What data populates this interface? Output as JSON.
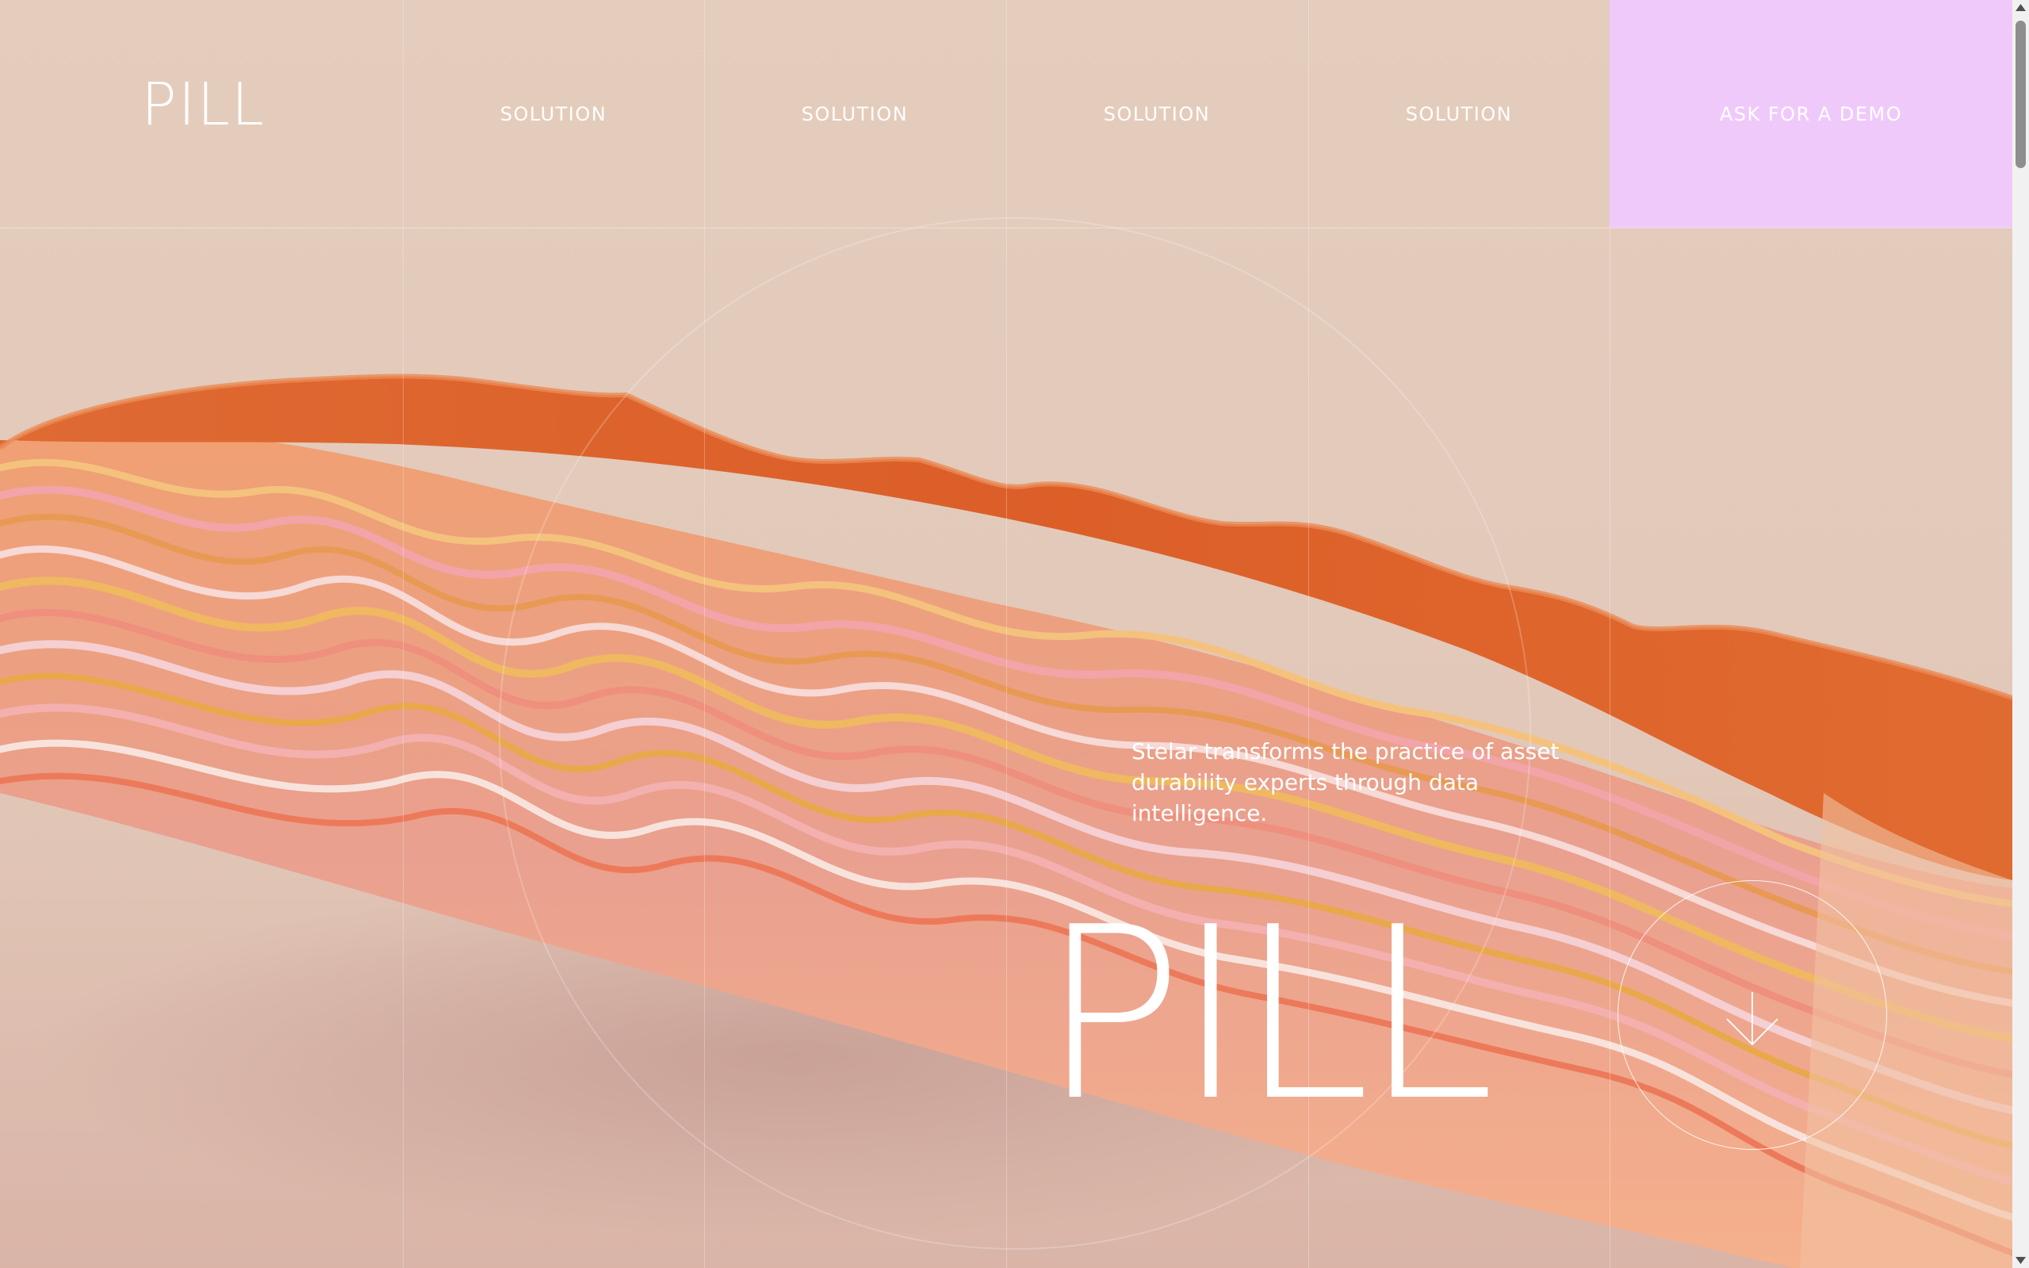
{
  "header": {
    "logo": "PILL",
    "nav": [
      {
        "label": "SOLUTION"
      },
      {
        "label": "SOLUTION"
      },
      {
        "label": "SOLUTION"
      },
      {
        "label": "SOLUTION"
      }
    ],
    "cta_label": "ASK FOR A DEMO"
  },
  "hero": {
    "tagline": "Stelar transforms the practice of asset durability experts through data intelligence.",
    "title": "PILL",
    "scroll_icon": "arrow-down-icon"
  },
  "colors": {
    "background": "#e4cdbd",
    "cta_background": "#f0c9fb",
    "text": "#ffffff",
    "sculpture_top": "#e0632a"
  }
}
